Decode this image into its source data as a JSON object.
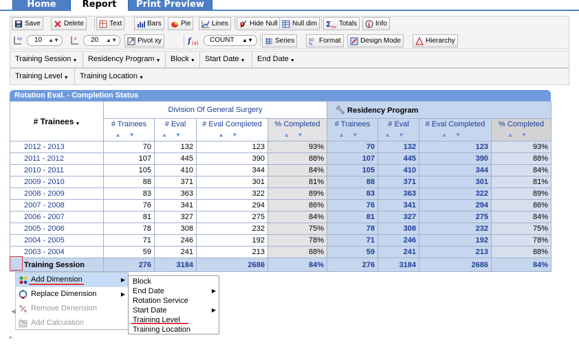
{
  "tabs": [
    {
      "label": "Home",
      "active": false
    },
    {
      "label": "Report",
      "active": true
    },
    {
      "label": "Print Preview",
      "active": false
    }
  ],
  "toolbar": {
    "save": "Save",
    "delete": "Delete",
    "text": "Text",
    "bars": "Bars",
    "pie": "Pie",
    "lines": "Lines",
    "hide_null": "Hide Null",
    "null_dim": "Null dim",
    "totals": "Totals",
    "info": "Info",
    "top_value": "10",
    "bottom_value": "20",
    "pivot": "Pivot xy",
    "func_value": "COUNT",
    "series": "Series",
    "format": "Format",
    "design_mode": "Design Mode",
    "hierarchy": "Hierarchy"
  },
  "dimensions_row1": [
    "Training Session",
    "Residency Program",
    "Block",
    "Start Date",
    "End Date"
  ],
  "dimensions_row2": [
    "Training Level",
    "Training Location"
  ],
  "report": {
    "title": "Rotation Eval. - Completion Status",
    "row_header": "# Trainees",
    "group_a": "Division Of General Surgery",
    "group_b": "Residency Program",
    "columns": [
      "# Trainees",
      "# Eval",
      "# Eval Completed",
      "% Completed"
    ],
    "rows": [
      {
        "label": "2012 - 2013",
        "a": [
          "70",
          "132",
          "123",
          "93%"
        ],
        "b": [
          "70",
          "132",
          "123",
          "93%"
        ]
      },
      {
        "label": "2011 - 2012",
        "a": [
          "107",
          "445",
          "390",
          "88%"
        ],
        "b": [
          "107",
          "445",
          "390",
          "88%"
        ]
      },
      {
        "label": "2010 - 2011",
        "a": [
          "105",
          "410",
          "344",
          "84%"
        ],
        "b": [
          "105",
          "410",
          "344",
          "84%"
        ]
      },
      {
        "label": "2009 - 2010",
        "a": [
          "88",
          "371",
          "301",
          "81%"
        ],
        "b": [
          "88",
          "371",
          "301",
          "81%"
        ]
      },
      {
        "label": "2008 - 2009",
        "a": [
          "83",
          "363",
          "322",
          "89%"
        ],
        "b": [
          "83",
          "363",
          "322",
          "89%"
        ]
      },
      {
        "label": "2007 - 2008",
        "a": [
          "76",
          "341",
          "294",
          "86%"
        ],
        "b": [
          "76",
          "341",
          "294",
          "86%"
        ]
      },
      {
        "label": "2006 - 2007",
        "a": [
          "81",
          "327",
          "275",
          "84%"
        ],
        "b": [
          "81",
          "327",
          "275",
          "84%"
        ]
      },
      {
        "label": "2005 - 2006",
        "a": [
          "78",
          "308",
          "232",
          "75%"
        ],
        "b": [
          "78",
          "308",
          "232",
          "75%"
        ]
      },
      {
        "label": "2004 - 2005",
        "a": [
          "71",
          "246",
          "192",
          "78%"
        ],
        "b": [
          "71",
          "246",
          "192",
          "78%"
        ]
      },
      {
        "label": "2003 - 2004",
        "a": [
          "59",
          "241",
          "213",
          "88%"
        ],
        "b": [
          "59",
          "241",
          "213",
          "88%"
        ]
      }
    ],
    "total_label": "Training Session",
    "totals": {
      "a": [
        "276",
        "3184",
        "2686",
        "84%"
      ],
      "b": [
        "276",
        "3184",
        "2686",
        "84%"
      ]
    }
  },
  "context_menu": {
    "add_dimension": "Add Dimension",
    "replace_dimension": "Replace Dimension",
    "remove_dimension": "Remove Dimension",
    "add_calculation": "Add Calculation"
  },
  "submenu": [
    "Block",
    "End Date",
    "Rotation Service",
    "Start Date",
    "Training Level",
    "Training Location"
  ]
}
